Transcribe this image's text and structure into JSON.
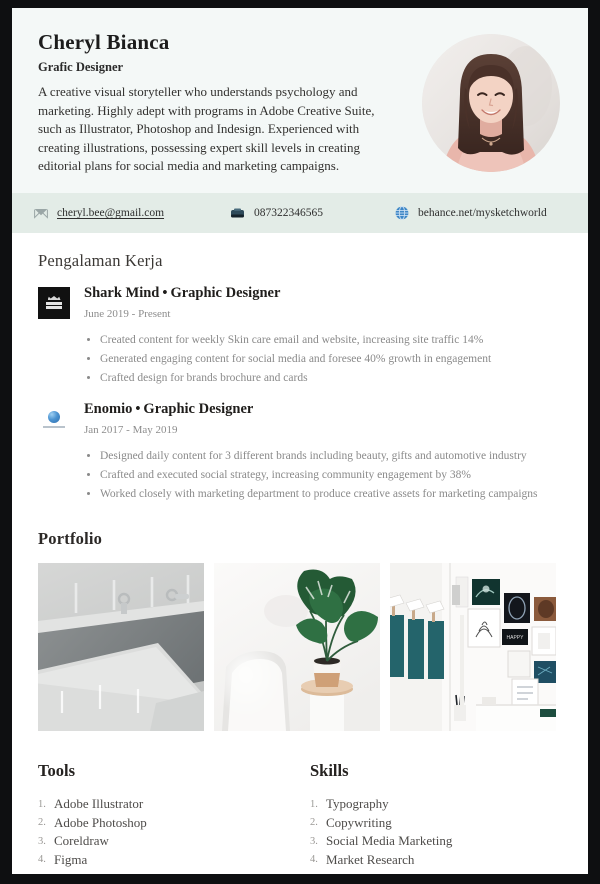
{
  "profile": {
    "name": "Cheryl Bianca",
    "role": "Grafic Designer",
    "summary": "A creative visual storyteller who understands psychology and marketing. Highly adept with programs in Adobe Creative Suite, such as Illustrator, Photoshop and Indesign. Experienced with creating illustrations, possessing expert skill levels in creating editorial plans for social media and marketing campaigns.",
    "photo_alt": "portrait-photo"
  },
  "contact": {
    "email": "cheryl.bee@gmail.com",
    "phone": "087322346565",
    "website": "behance.net/mysketchworld",
    "icons": {
      "email": "envelope-icon",
      "phone": "phone-icon",
      "website": "globe-icon"
    }
  },
  "experience": {
    "title": "Pengalaman Kerja",
    "jobs": [
      {
        "company": "Shark Mind",
        "separator": "•",
        "position": "Graphic Designer",
        "date": "June 2019 - Present",
        "logo": "shark-mind-logo",
        "bullets": [
          "Created content for weekly Skin care email and website, increasing site traffic 14%",
          "Generated engaging content for social media and foresee  40% growth in engagement",
          "Crafted design for brands brochure and cards"
        ]
      },
      {
        "company": "Enomio",
        "separator": "•",
        "position": "Graphic Designer",
        "date": "Jan 2017 - May 2019",
        "logo": "enomio-logo",
        "bullets": [
          "Designed daily content for 3 different brands including beauty, gifts and automotive industry",
          "Crafted and executed social strategy, increasing community engagement by 38%",
          "Worked closely with marketing department to produce creative assets for marketing campaigns"
        ]
      }
    ]
  },
  "portfolio": {
    "title": "Portfolio",
    "items": [
      {
        "alt": "gray-architectural-stairs-photo"
      },
      {
        "alt": "white-chair-monstera-plant-photo"
      },
      {
        "alt": "gallery-wall-prints-photo"
      }
    ]
  },
  "tools": {
    "title": "Tools",
    "items": [
      "Adobe Illustrator",
      "Adobe Photoshop",
      "Coreldraw",
      "Figma"
    ]
  },
  "skills": {
    "title": "Skills",
    "items": [
      "Typography",
      "Copywriting",
      "Social Media Marketing",
      "Market Research"
    ]
  },
  "colors": {
    "header_bg": "#f4f8f7",
    "contact_bg": "#e3ece7",
    "page_bg": "#ffffff",
    "frame": "#0e0f11",
    "heading": "#3b3835",
    "muted_text": "#8a8a8a",
    "globe_blue": "#3d86c6"
  }
}
